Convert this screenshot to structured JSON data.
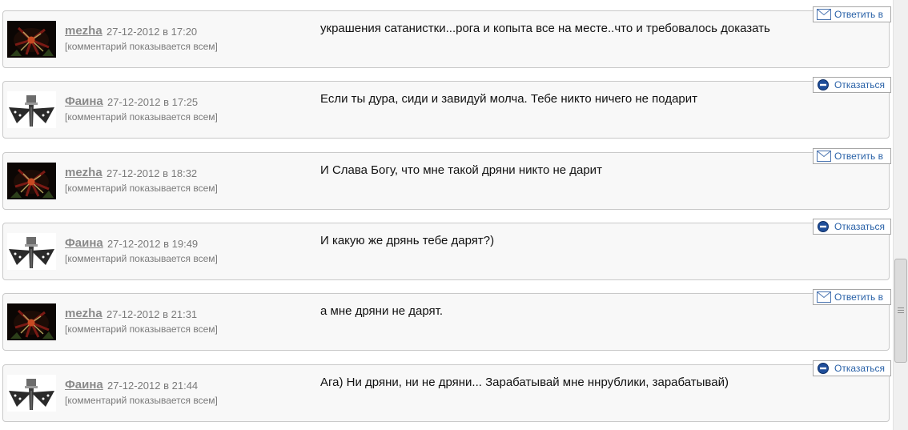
{
  "comments": [
    {
      "author": "mezha",
      "date": "27-12-2012 в 17:20",
      "visibility": "[комментарий показывается всем]",
      "text": "украшения сатанистки...рога и копыта все на месте..что и требовалось доказать",
      "action": "Ответить в",
      "action_icon": "envelope-icon",
      "avatar": "mezha"
    },
    {
      "author": "Фаина",
      "date": "27-12-2012 в 17:25",
      "visibility": "[комментарий показывается всем]",
      "text": "Если ты дура, сиди и завидуй молча. Тебе никто ничего не подарит",
      "action": "Отказаться",
      "action_icon": "minus-circle-icon",
      "avatar": "faina"
    },
    {
      "author": "mezha",
      "date": "27-12-2012 в 18:32",
      "visibility": "[комментарий показывается всем]",
      "text": "И Слава Богу, что мне такой дряни никто не дарит",
      "action": "Ответить в",
      "action_icon": "envelope-icon",
      "avatar": "mezha"
    },
    {
      "author": "Фаина",
      "date": "27-12-2012 в 19:49",
      "visibility": "[комментарий показывается всем]",
      "text": "И какую же дрянь тебе дарят?)",
      "action": "Отказаться",
      "action_icon": "minus-circle-icon",
      "avatar": "faina"
    },
    {
      "author": "mezha",
      "date": "27-12-2012 в 21:31",
      "visibility": "[комментарий показывается всем]",
      "text": "а мне дряни не дарят.",
      "action": "Ответить в",
      "action_icon": "envelope-icon",
      "avatar": "mezha"
    },
    {
      "author": "Фаина",
      "date": "27-12-2012 в 21:44",
      "visibility": "[комментарий показывается всем]",
      "text": "Ага) Ни дряни, ни не дряни... Зарабатывай мне ннрублики, зарабатывай)",
      "action": "Отказаться",
      "action_icon": "minus-circle-icon",
      "avatar": "faina"
    }
  ],
  "colors": {
    "link": "#2a62a8",
    "meta": "#7a7a7a",
    "card_bg": "#f8f8f8",
    "card_border": "#c9c9c9"
  }
}
